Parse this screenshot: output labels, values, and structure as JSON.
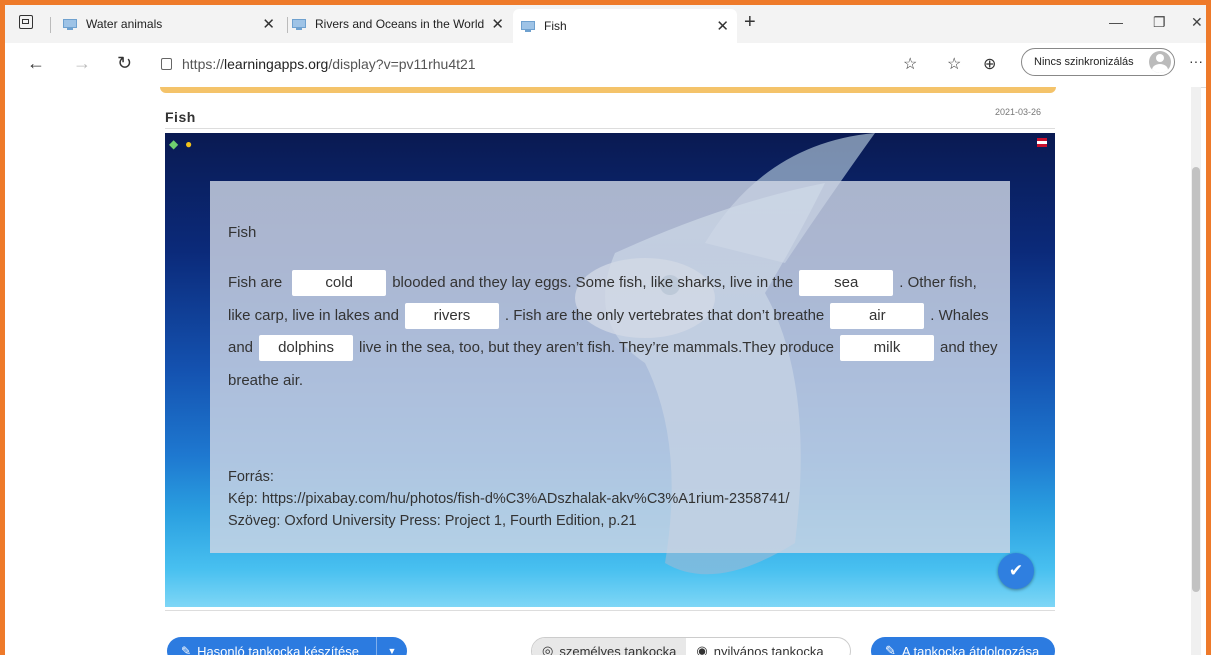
{
  "browser": {
    "tabs": [
      {
        "label": "Water animals",
        "active": false
      },
      {
        "label": "Rivers and Oceans in the World",
        "active": false
      },
      {
        "label": "Fish",
        "active": true
      }
    ],
    "new_tab": "+",
    "window_controls": {
      "minimize": "—",
      "restore": "❐",
      "close": "✕"
    },
    "url_prefix": "https://",
    "url_domain": "learningapps.org",
    "url_path": "/display?v=pv11rhu4t21",
    "sync_label": "Nincs szinkronizálás",
    "more": "···"
  },
  "app": {
    "title": "Fish",
    "date": "2021-03-26",
    "panel_title": "Fish",
    "text": {
      "t1": "Fish are",
      "g1": "cold",
      "t2": "blooded and they lay eggs. Some fish, like sharks, live in the",
      "g2": "sea",
      "t3": ". Other fish, like carp, live in lakes and",
      "g3": "rivers",
      "t4": ". Fish are the only vertebrates that don’t breathe",
      "g4": "air",
      "t5": ". Whales and",
      "g5": "dolphins",
      "t6": "live in the sea, too, but they aren’t fish. They’re mammals.They produce",
      "g6": "milk",
      "t7": "and they breathe air."
    },
    "source": {
      "heading": "Forrás:",
      "image": "Kép: https://pixabay.com/hu/photos/fish-d%C3%ADszhalak-akv%C3%A1rium-2358741/",
      "text": "Szöveg: Oxford University Press: Project 1, Fourth Edition, p.21"
    }
  },
  "footer": {
    "similar_button": "Hasonló tankocka készítése",
    "personal": "személyes tankocka",
    "public": "nyilvános tankocka",
    "edit_button": "A tankocka átdolgozása"
  }
}
